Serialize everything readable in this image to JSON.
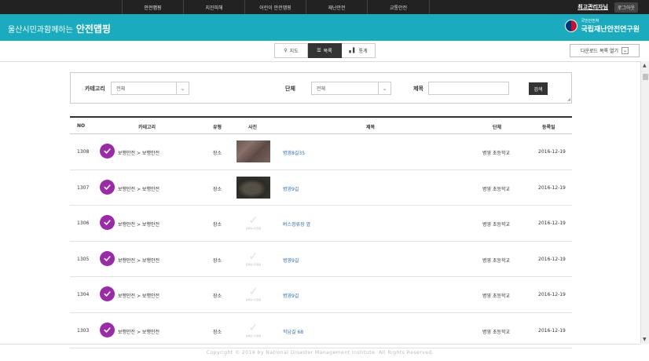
{
  "top_nav": {
    "items": [
      "안전맵핑",
      "지진피해",
      "어린이 안전맵핑",
      "재난안전",
      "교통안전"
    ],
    "admin_label": "최고관리자님",
    "logout_label": "로그아웃"
  },
  "header": {
    "brand_sub": "울산시민과함께하는",
    "brand_main": "안전맵핑",
    "inst_small": "국민안전처",
    "inst_big": "국립재난안전연구원"
  },
  "view_tabs": [
    {
      "icon": "map-pin-icon",
      "label": "지도"
    },
    {
      "icon": "list-icon",
      "label": "목록"
    },
    {
      "icon": "bar-chart-icon",
      "label": "통계"
    }
  ],
  "download_label": "다운로드 목록 열기",
  "search": {
    "category_label": "카테고리",
    "category_value": "전체",
    "group_label": "단체",
    "group_value": "전체",
    "title_label": "제목",
    "title_value": "",
    "button_label": "검색"
  },
  "table": {
    "headers": [
      "NO",
      "카테고리",
      "유형",
      "사진",
      "제목",
      "단체",
      "등록일"
    ],
    "no_photo_text": "등록된사진없음",
    "rows": [
      {
        "no": "1308",
        "category": "보행안전 > 보행안전",
        "type": "장소",
        "photo": "p1",
        "title": "병영8길35",
        "group": "병영 초등학교",
        "date": "2016-12-19"
      },
      {
        "no": "1307",
        "category": "보행안전 > 보행안전",
        "type": "장소",
        "photo": "p2",
        "title": "병영9길",
        "group": "병영 초등학교",
        "date": "2016-12-19"
      },
      {
        "no": "1306",
        "category": "보행안전 > 보행안전",
        "type": "장소",
        "photo": "none",
        "title": "버스정류장 옆",
        "group": "병영 초등학교",
        "date": "2016-12-19"
      },
      {
        "no": "1305",
        "category": "보행안전 > 보행안전",
        "type": "장소",
        "photo": "none",
        "title": "병영9길",
        "group": "병영 초등학교",
        "date": "2016-12-19"
      },
      {
        "no": "1304",
        "category": "보행안전 > 보행안전",
        "type": "장소",
        "photo": "none",
        "title": "병영9길",
        "group": "병영 초등학교",
        "date": "2016-12-19"
      },
      {
        "no": "1303",
        "category": "보행안전 > 보행안전",
        "type": "장소",
        "photo": "none",
        "title": "학남길 68",
        "group": "병영 초등학교",
        "date": "2016-12-19"
      }
    ]
  },
  "footer": {
    "copyright": "Copyright © 2016 by National Disaster Management Institute. All Rights Reserved."
  },
  "colors": {
    "header_bg": "#1aabbf",
    "check_purple": "#9b2aa8",
    "link_blue": "#2c6fb5"
  }
}
